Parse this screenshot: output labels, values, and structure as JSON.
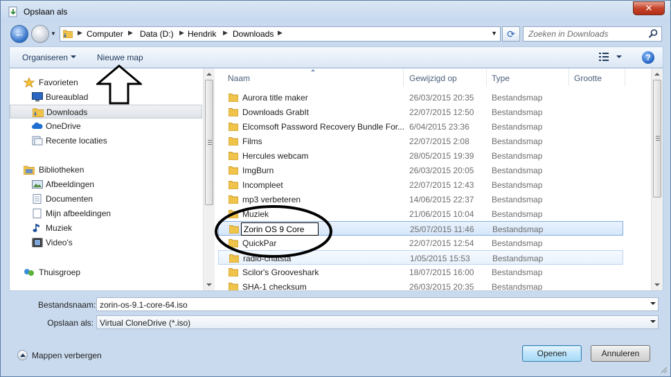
{
  "window": {
    "title": "Opslaan als",
    "close_label": "✕"
  },
  "address": {
    "crumbs": [
      "Computer",
      "Data (D:)",
      "Hendrik",
      "Downloads"
    ],
    "search_placeholder": "Zoeken in Downloads"
  },
  "toolbar": {
    "organize": "Organiseren",
    "new_folder": "Nieuwe map",
    "help": "?"
  },
  "nav": {
    "favorites": "Favorieten",
    "fav_items": [
      "Bureaublad",
      "Downloads",
      "OneDrive",
      "Recente locaties"
    ],
    "libraries": "Bibliotheken",
    "lib_items": [
      "Afbeeldingen",
      "Documenten",
      "Mijn afbeeldingen",
      "Muziek",
      "Video's"
    ],
    "homegroup": "Thuisgroep"
  },
  "columns": {
    "name": "Naam",
    "modified": "Gewijzigd op",
    "type": "Type",
    "size": "Grootte"
  },
  "files": [
    {
      "name": "Aurora title maker",
      "date": "26/03/2015 20:35",
      "type": "Bestandsmap"
    },
    {
      "name": "Downloads GrabIt",
      "date": "22/07/2015 12:50",
      "type": "Bestandsmap"
    },
    {
      "name": "Elcomsoft Password Recovery Bundle For...",
      "date": "6/04/2015 23:36",
      "type": "Bestandsmap"
    },
    {
      "name": "Films",
      "date": "22/07/2015 2:08",
      "type": "Bestandsmap"
    },
    {
      "name": "Hercules webcam",
      "date": "28/05/2015 19:39",
      "type": "Bestandsmap"
    },
    {
      "name": "ImgBurn",
      "date": "26/03/2015 20:05",
      "type": "Bestandsmap"
    },
    {
      "name": "Incompleet",
      "date": "22/07/2015 12:43",
      "type": "Bestandsmap"
    },
    {
      "name": "mp3 verbeteren",
      "date": "14/06/2015 22:37",
      "type": "Bestandsmap"
    },
    {
      "name": "Muziek",
      "date": "21/06/2015 10:04",
      "type": "Bestandsmap"
    },
    {
      "name": "Zorin OS 9 Core",
      "date": "25/07/2015 11:46",
      "type": "Bestandsmap"
    },
    {
      "name": "QuickPar",
      "date": "22/07/2015 12:54",
      "type": "Bestandsmap"
    },
    {
      "name": "radio-chatsta",
      "date": "1/05/2015 15:53",
      "type": "Bestandsmap"
    },
    {
      "name": "Scilor's Grooveshark",
      "date": "18/07/2015 16:00",
      "type": "Bestandsmap"
    },
    {
      "name": "SHA-1 checksum",
      "date": "26/03/2015 20:35",
      "type": "Bestandsmap"
    }
  ],
  "rename_value": "Zorin OS 9 Core",
  "form": {
    "filename_label": "Bestandsnaam:",
    "filename_value": "zorin-os-9.1-core-64.iso",
    "saveas_label": "Opslaan als:",
    "saveas_value": "Virtual CloneDrive (*.iso)"
  },
  "footer": {
    "hide_folders": "Mappen verbergen",
    "open": "Openen",
    "cancel": "Annuleren"
  },
  "colors": {
    "folder": "#f0c34a",
    "accent": "#3c7fb1",
    "annotation": "#000000"
  }
}
